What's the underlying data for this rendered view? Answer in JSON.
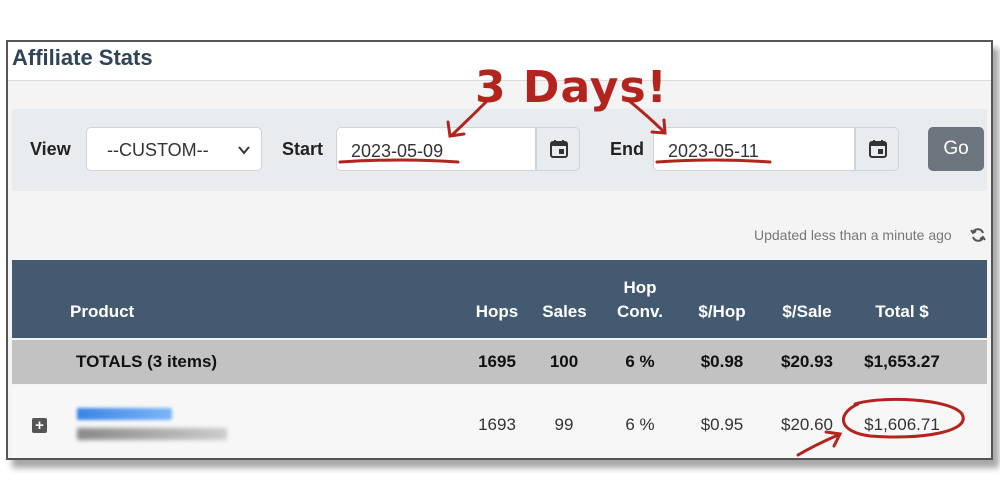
{
  "page": {
    "title": "Affiliate Stats"
  },
  "filters": {
    "view_label": "View",
    "view_value": "--CUSTOM--",
    "start_label": "Start",
    "start_value": "2023-05-09",
    "end_label": "End",
    "end_value": "2023-05-11",
    "go_label": "Go"
  },
  "status": {
    "updated": "Updated less than a minute ago"
  },
  "table": {
    "headers": {
      "product": "Product",
      "hops": "Hops",
      "sales": "Sales",
      "hop_conv_line1": "Hop",
      "hop_conv_line2": "Conv.",
      "per_hop": "$/Hop",
      "per_sale": "$/Sale",
      "total": "Total $"
    },
    "totals": {
      "label": "TOTALS (3 items)",
      "hops": "1695",
      "sales": "100",
      "hop_conv": "6 %",
      "per_hop": "$0.98",
      "per_sale": "$20.93",
      "total": "$1,653.27"
    },
    "rows": [
      {
        "hops": "1693",
        "sales": "99",
        "hop_conv": "6 %",
        "per_hop": "$0.95",
        "per_sale": "$20.60",
        "total": "$1,606.71"
      }
    ]
  },
  "annotation": {
    "text": "3 Days!",
    "color": "#b3241e"
  },
  "colors": {
    "header_bg": "#435a70",
    "totals_bg": "#c2c2c2",
    "title": "#2f4458",
    "go_button": "#6c757d"
  }
}
